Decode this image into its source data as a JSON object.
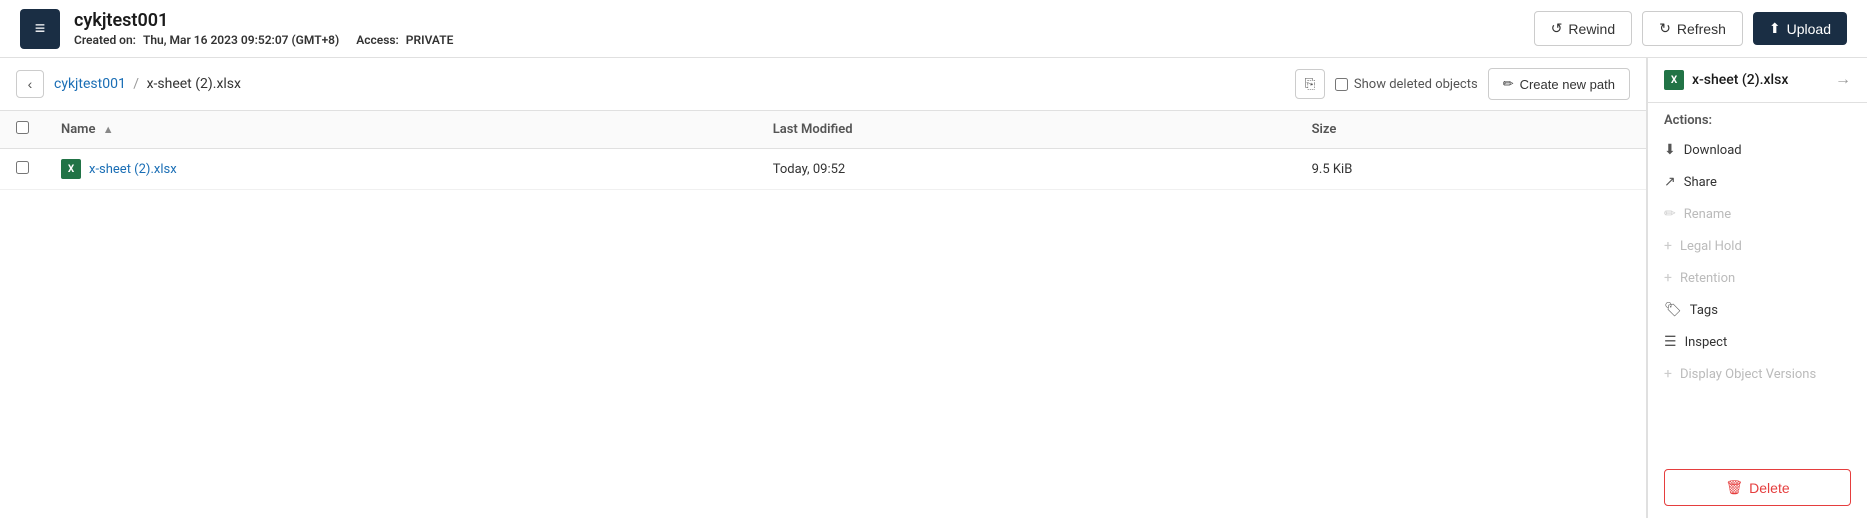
{
  "header": {
    "logo_text": "≡",
    "app_title": "cykjtest001",
    "created_label": "Created on:",
    "created_value": "Thu, Mar 16 2023 09:52:07 (GMT+8)",
    "access_label": "Access:",
    "access_value": "PRIVATE",
    "rewind_label": "Rewind",
    "refresh_label": "Refresh",
    "upload_label": "Upload"
  },
  "breadcrumb": {
    "root": "cykjtest001",
    "separator": "/",
    "current": "x-sheet (2).xlsx",
    "copy_tooltip": "Copy path",
    "show_deleted_label": "Show deleted objects",
    "create_path_label": "Create new path"
  },
  "table": {
    "col_select": "",
    "col_name": "Name",
    "col_modified": "Last Modified",
    "col_size": "Size",
    "rows": [
      {
        "name": "x-sheet (2).xlsx",
        "modified": "Today, 09:52",
        "size": "9.5 KiB"
      }
    ]
  },
  "right_panel": {
    "title": "x-sheet (2).xlsx",
    "close_icon": "→",
    "actions_label": "Actions:",
    "actions": [
      {
        "id": "download",
        "label": "Download",
        "icon": "⬇",
        "disabled": false
      },
      {
        "id": "share",
        "label": "Share",
        "icon": "↗",
        "disabled": false
      },
      {
        "id": "rename",
        "label": "Rename",
        "icon": "✏",
        "disabled": true
      },
      {
        "id": "legal-hold",
        "label": "Legal Hold",
        "icon": "+",
        "disabled": true
      },
      {
        "id": "retention",
        "label": "Retention",
        "icon": "+",
        "disabled": true
      },
      {
        "id": "tags",
        "label": "Tags",
        "icon": "🏷",
        "disabled": false
      },
      {
        "id": "inspect",
        "label": "Inspect",
        "icon": "☰",
        "disabled": false
      },
      {
        "id": "display-version",
        "label": "Display Object Versions",
        "icon": "+",
        "disabled": true
      }
    ],
    "delete_label": "Delete",
    "delete_icon": "🗑"
  }
}
